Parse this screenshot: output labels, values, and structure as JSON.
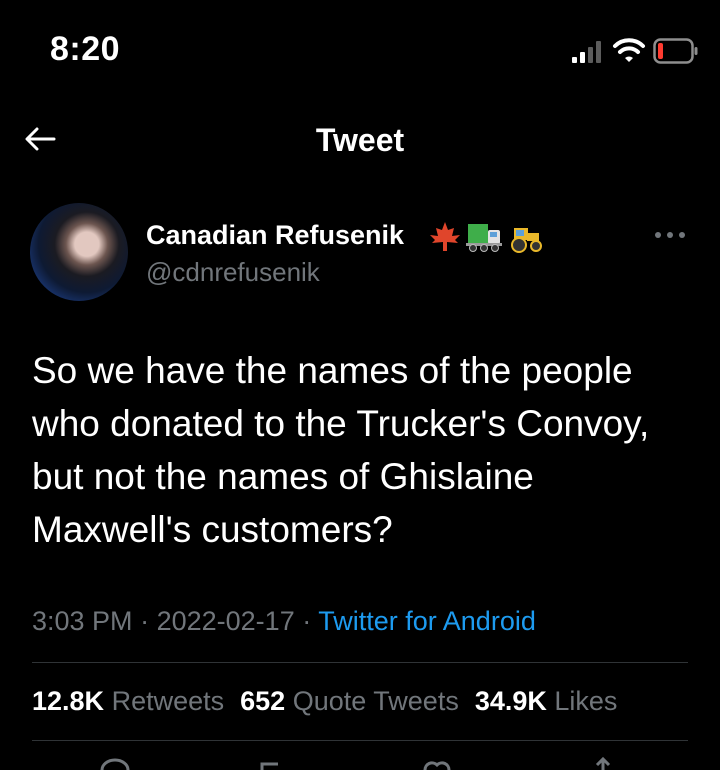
{
  "status_bar": {
    "time": "8:20"
  },
  "nav": {
    "title": "Tweet"
  },
  "tweet": {
    "display_name": "Canadian Refusenik",
    "handle": "@cdnrefusenik",
    "text": "So we have the names of the people who donated to the Trucker's Convoy, but not the names of Ghislaine Maxwell's customers?",
    "time": "3:03 PM",
    "date": "2022-02-17",
    "separator": "·",
    "source": "Twitter for Android",
    "name_badges": [
      "maple-leaf-icon",
      "truck-icon",
      "tractor-icon"
    ]
  },
  "stats": {
    "retweets_count": "12.8K",
    "retweets_label": "Retweets",
    "quotes_count": "652",
    "quotes_label": "Quote Tweets",
    "likes_count": "34.9K",
    "likes_label": "Likes"
  },
  "colors": {
    "background": "#000000",
    "text": "#ffffff",
    "muted": "#71767b",
    "link": "#1d9bf0",
    "divider": "#2f3336"
  }
}
